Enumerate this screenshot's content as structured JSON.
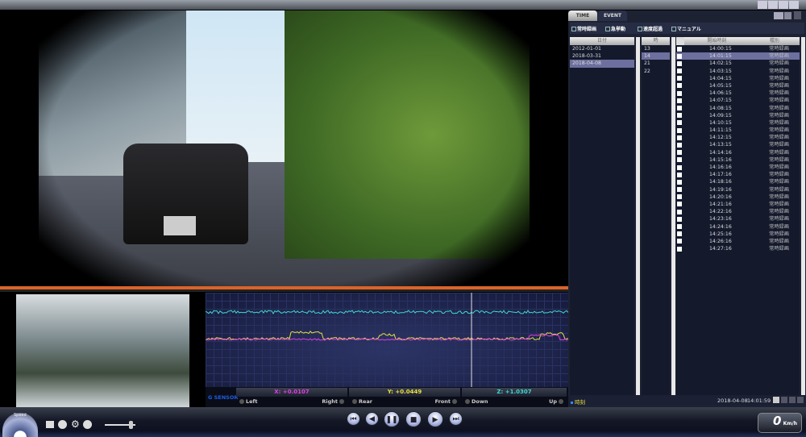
{
  "window": {
    "controls": [
      "restore-icon",
      "minimize-icon",
      "maximize-icon",
      "close-icon"
    ]
  },
  "tabs": [
    {
      "label": "TIME",
      "active": true
    },
    {
      "label": "EVENT",
      "active": false
    }
  ],
  "filters": [
    {
      "label": "常時録画",
      "checked": true
    },
    {
      "label": "急挙動",
      "checked": true
    },
    {
      "label": "速度超過",
      "checked": true
    },
    {
      "label": "マニュアル",
      "checked": true
    }
  ],
  "columns": {
    "date": "日付",
    "hour": "時",
    "start": "開始時刻",
    "type": "種別"
  },
  "dates": [
    {
      "v": "2012-01-01"
    },
    {
      "v": "2018-03-31"
    },
    {
      "v": "2018-04-08",
      "selected": true
    }
  ],
  "hours": [
    {
      "v": "13"
    },
    {
      "v": "14",
      "selected": true
    },
    {
      "v": "21"
    },
    {
      "v": "22"
    }
  ],
  "files": [
    "14:00:15",
    "14:01:15",
    "14:02:15",
    "14:03:15",
    "14:04:15",
    "14:05:15",
    "14:06:15",
    "14:07:15",
    "14:08:15",
    "14:09:15",
    "14:10:15",
    "14:11:15",
    "14:12:15",
    "14:13:15",
    "14:14:16",
    "14:15:16",
    "14:16:16",
    "14:17:16",
    "14:18:16",
    "14:19:16",
    "14:20:16",
    "14:21:16",
    "14:22:16",
    "14:23:16",
    "14:24:16",
    "14:25:16",
    "14:26:16",
    "14:27:16"
  ],
  "file_type": "常時録画",
  "selected_file": "14:01:15",
  "gsensor": {
    "title": "G SENSOR",
    "x": "X: +0.0107",
    "y": "Y: +0.0449",
    "z": "Z: +1.0307",
    "x_left": "Left",
    "x_right": "Right",
    "y_left": "Rear",
    "y_right": "Front",
    "z_left": "Down",
    "z_right": "Up",
    "colors": {
      "x": "#e040e0",
      "y": "#e8e040",
      "z": "#40d8d0"
    }
  },
  "status": {
    "label": "時刻",
    "date": "2018-04-08",
    "time": "14:01:59"
  },
  "speed": {
    "gauge_label": "Speed",
    "value": "0",
    "unit": "Km/h"
  },
  "accent": "#d9642a"
}
